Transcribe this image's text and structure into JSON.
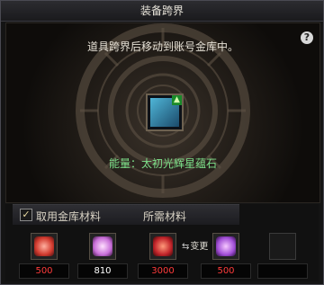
{
  "window": {
    "title": "装备跨界"
  },
  "panel": {
    "message": "道具跨界后移动到账号金库中。",
    "energy_text": "能量：太初光辉星蕴石"
  },
  "materials": {
    "use_vault_label": "取用金库材料",
    "required_label": "所需材料",
    "swap_label": "变更",
    "slots": [
      {
        "name": "material-slot-1",
        "color": "#d13a2e",
        "qty": "500",
        "qty_color": "#ff3b3b"
      },
      {
        "name": "material-slot-2",
        "color": "#c86fd8",
        "qty": "810",
        "qty_color": "#ffffff"
      },
      {
        "name": "material-slot-3",
        "color": "#c0242a",
        "qty": "3000",
        "qty_color": "#ff3b3b"
      },
      {
        "name": "material-slot-4",
        "color": "#a24fd6",
        "qty": "500",
        "qty_color": "#ff3b3b"
      }
    ]
  }
}
